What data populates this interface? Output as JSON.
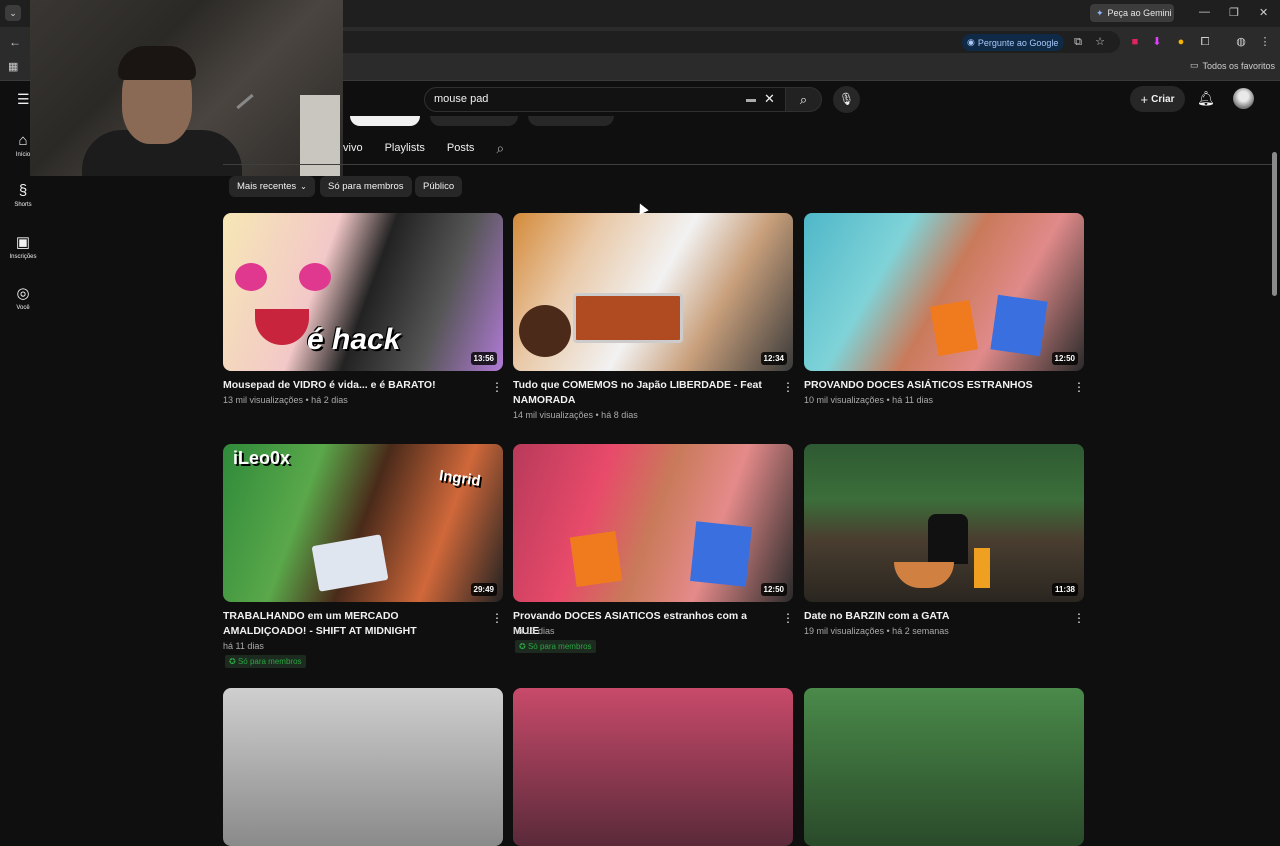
{
  "browser": {
    "gemini_label": "Peça ao Gemini",
    "ask_google_label": "Pergunte ao Google",
    "favorites_label": "Todos os favoritos"
  },
  "rail": {
    "items": [
      {
        "label": "Início",
        "icon": "home-icon"
      },
      {
        "label": "Shorts",
        "icon": "shorts-icon"
      },
      {
        "label": "Inscrições",
        "icon": "subscriptions-icon"
      },
      {
        "label": "Você",
        "icon": "you-icon"
      }
    ]
  },
  "header": {
    "search_value": "mouse pad",
    "create_label": "Criar"
  },
  "channel_tabs": {
    "items": [
      "vivo",
      "Playlists",
      "Posts"
    ]
  },
  "filters": {
    "sort_label": "Mais recentes",
    "members_only_label": "Só para membros",
    "public_label": "Público"
  },
  "videos": [
    {
      "title": "Mousepad de VIDRO é vida... e é BARATO!",
      "meta": "13 mil visualizações • há 2 dias",
      "duration": "13:56"
    },
    {
      "title": "Tudo que COMEMOS no Japão LIBERDADE - Feat NAMORADA",
      "meta": "14 mil visualizações • há 8 dias",
      "duration": "12:34"
    },
    {
      "title": "PROVANDO DOCES ASIÁTICOS ESTRANHOS",
      "meta": "10 mil visualizações • há 11 dias",
      "duration": "12:50"
    },
    {
      "title": "TRABALHANDO em um MERCADO AMALDIÇOADO! - SHIFT AT MIDNIGHT",
      "meta": "há 11 dias",
      "duration": "29:49",
      "badge": "Só para membros"
    },
    {
      "title": "Provando DOCES ASIATICOS estranhos com a MUIE",
      "meta": "há 13 dias",
      "duration": "12:50",
      "badge": "Só para membros"
    },
    {
      "title": "Date no BARZIN com a GATA",
      "meta": "19 mil visualizações • há 2 semanas",
      "duration": "11:38"
    }
  ],
  "thumbnail_text": {
    "v1": "é hack",
    "v4_name": "iLeo0x",
    "v4_name2": "Ingrid"
  },
  "colors": {
    "background": "#0f0f0f",
    "members_green": "#2ba640",
    "ask_google_blue": "#a8c7fa"
  }
}
